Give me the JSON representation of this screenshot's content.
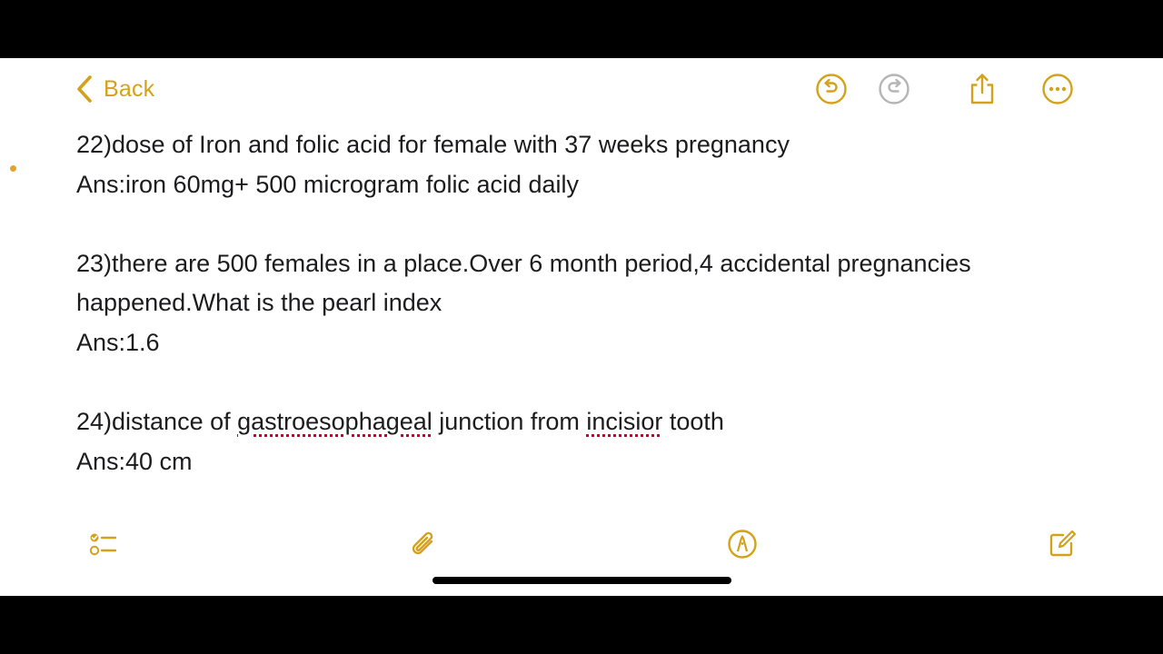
{
  "nav": {
    "back_label": "Back"
  },
  "toolbar_icons": [
    "undo-icon",
    "redo-icon",
    "share-icon",
    "more-icon"
  ],
  "note": {
    "q22": {
      "question": "22)dose of Iron and folic acid for female with 37 weeks pregnancy",
      "answer": "Ans:iron 60mg+ 500 microgram folic acid daily"
    },
    "q23": {
      "question_line1": "23)there are 500 females in a place.Over 6 month period,4 accidental pregnancies",
      "question_line2": "happened.What is the pearl index",
      "answer": "Ans:1.6"
    },
    "q24": {
      "prefix": "24)distance of ",
      "word1": "gastroesophageal",
      "middle": " junction from ",
      "word2": "incisior",
      "suffix": " tooth",
      "answer": "Ans:40 cm"
    }
  },
  "bottom_icons": [
    "checklist-icon",
    "attachment-icon",
    "markup-icon",
    "compose-icon"
  ],
  "colors": {
    "accent": "#d4a21a",
    "disabled_icon": "#b5b5b5",
    "text": "#1c1c1e",
    "spellcheck": "#d0021b"
  }
}
